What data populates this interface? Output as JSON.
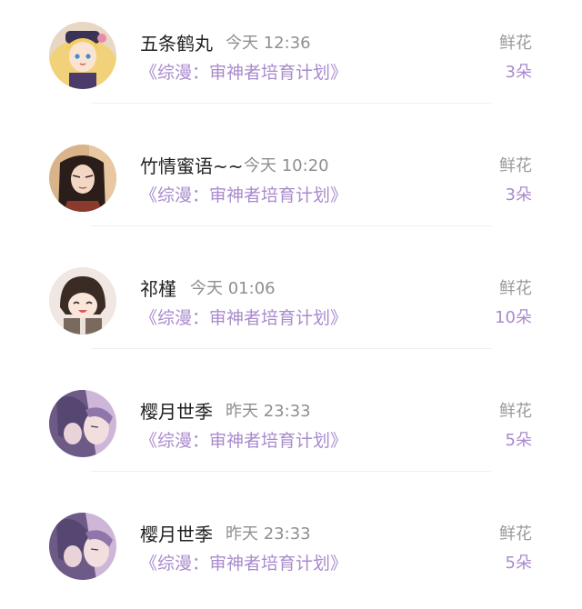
{
  "items": [
    {
      "name": "五条鹤丸",
      "time": "今天 12:36",
      "book": "《综漫：审神者培育计划》",
      "gift": "鲜花",
      "count": "3朵",
      "avatar": "avatar-blonde-girl-icon"
    },
    {
      "name": "竹情蜜语~~",
      "time": "今天 10:20",
      "book": "《综漫：审神者培育计划》",
      "gift": "鲜花",
      "count": "3朵",
      "avatar": "avatar-dark-hair-man-icon"
    },
    {
      "name": "祁槿",
      "time": "今天 01:06",
      "book": "《综漫：审神者培育计划》",
      "gift": "鲜花",
      "count": "10朵",
      "avatar": "avatar-chibi-boy-icon"
    },
    {
      "name": "樱月世季",
      "time": "昨天 23:33",
      "book": "《综漫：审神者培育计划》",
      "gift": "鲜花",
      "count": "5朵",
      "avatar": "avatar-purple-hair-icon"
    },
    {
      "name": "樱月世季",
      "time": "昨天 23:33",
      "book": "《综漫：审神者培育计划》",
      "gift": "鲜花",
      "count": "5朵",
      "avatar": "avatar-purple-hair-icon"
    }
  ],
  "colors": {
    "accent": "#a98acd",
    "name": "#222222",
    "muted": "#9a9a9a"
  }
}
